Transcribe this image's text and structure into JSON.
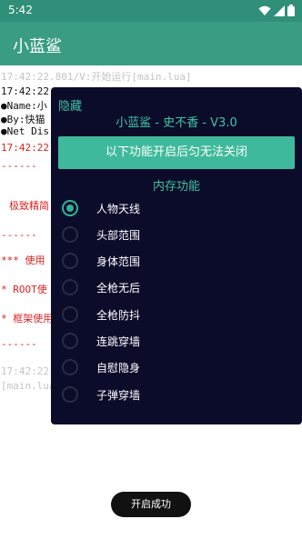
{
  "status": {
    "time": "5:42"
  },
  "app": {
    "title": "小蓝鲨"
  },
  "log": {
    "line1": "17:42:22.801/V:开始运行[main.lua]",
    "line2": "17:42:22.8",
    "line3": "●Name:小",
    "line4": "●By:快猫",
    "line5": "●Net Dis",
    "line6": "17:42:22.",
    "line7": "------",
    "line8": "极致精简",
    "line9": "------",
    "line10": "*** 使用",
    "line11": "* ROOT使",
    "line12": "* 框架使用",
    "line13": "------",
    "line14": "17:42:22.",
    "line15": "[main.lua"
  },
  "panel": {
    "hide_label": "隐藏",
    "title": "小蓝鲨 - 史不香 - V3.0",
    "warning": "以下功能开启后匀无法关闭",
    "section": "内存功能",
    "options": [
      {
        "label": "人物天线",
        "checked": true
      },
      {
        "label": "头部范围",
        "checked": false
      },
      {
        "label": "身体范围",
        "checked": false
      },
      {
        "label": "全枪无后",
        "checked": false
      },
      {
        "label": "全枪防抖",
        "checked": false
      },
      {
        "label": "连跳穿墙",
        "checked": false
      },
      {
        "label": "自慰隐身",
        "checked": false
      },
      {
        "label": "子弹穿墙",
        "checked": false
      }
    ]
  },
  "toast": {
    "text": "开启成功"
  }
}
